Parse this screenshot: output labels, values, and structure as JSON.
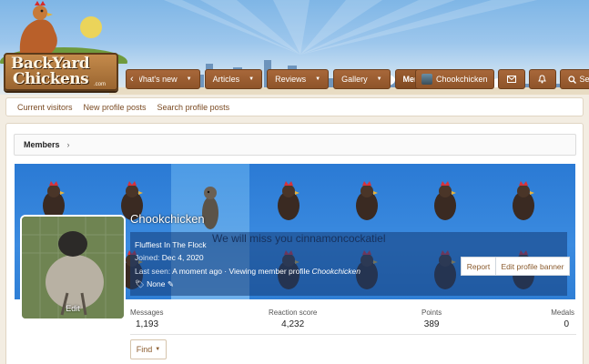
{
  "header": {
    "logo_line1": "BackYard",
    "logo_line2": "Chickens",
    "logo_com": ".com"
  },
  "nav": {
    "tabs": [
      {
        "label": "What's new"
      },
      {
        "label": "Articles"
      },
      {
        "label": "Reviews"
      },
      {
        "label": "Gallery"
      },
      {
        "label": "Members"
      }
    ],
    "username": "Chookchicken",
    "search_label": "Search"
  },
  "subnav": {
    "links": [
      "Current visitors",
      "New profile posts",
      "Search profile posts"
    ]
  },
  "breadcrumb": {
    "label": "Members"
  },
  "profile": {
    "name": "Chookchicken",
    "title": "Fluffiest In The Flock",
    "joined_label": "Joined:",
    "joined": "Dec 4, 2020",
    "last_seen_label": "Last seen:",
    "last_seen": "A moment ago · Viewing member profile",
    "last_seen_name": "Chookchicken",
    "tags": "None",
    "memory_text": "We will miss you cinnamoncockatiel",
    "report_label": "Report",
    "edit_banner_label": "Edit profile banner",
    "edit_avatar_label": "Edit"
  },
  "stats": [
    {
      "label": "Messages",
      "value": "1,193"
    },
    {
      "label": "Reaction score",
      "value": "4,232"
    },
    {
      "label": "Points",
      "value": "389"
    },
    {
      "label": "Medals",
      "value": "0"
    }
  ],
  "find_label": "Find",
  "colors": {
    "nav_brown": "#9c5e31",
    "link_brown": "#7a4a22",
    "banner_blue": "#2f7fd6",
    "page_bg": "#f3ede2"
  }
}
